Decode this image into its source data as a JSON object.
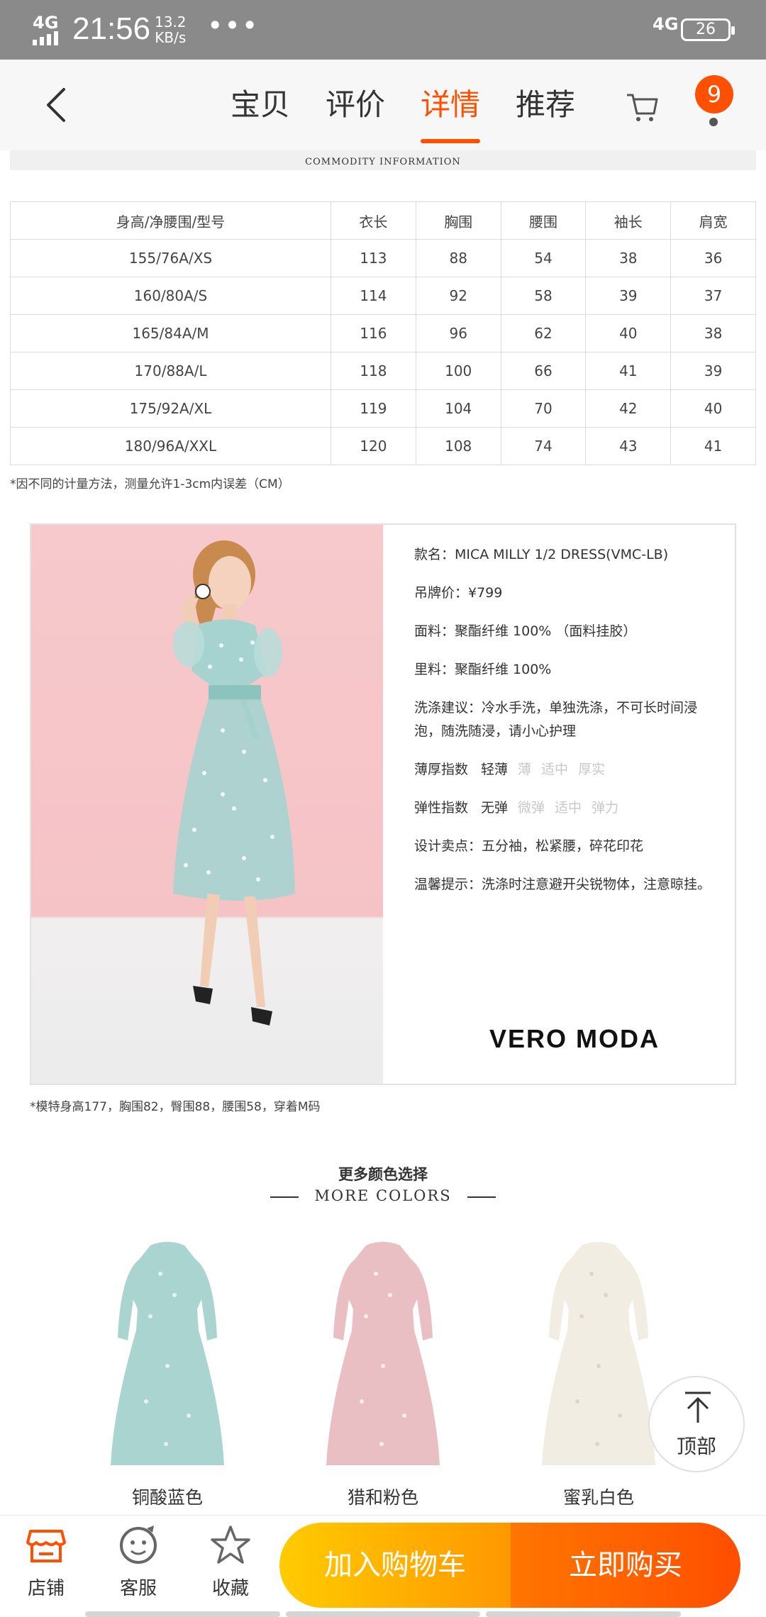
{
  "status_bar": {
    "network_left": "4G",
    "time": "21:56",
    "speed_value": "13.2",
    "speed_unit": "KB/s",
    "more": "•••",
    "network_right": "4G",
    "battery": "26"
  },
  "nav": {
    "tabs": [
      {
        "label": "宝贝",
        "active": false
      },
      {
        "label": "评价",
        "active": false
      },
      {
        "label": "详情",
        "active": true
      },
      {
        "label": "推荐",
        "active": false
      }
    ],
    "cart_badge": "9",
    "accent_color": "#ff5000"
  },
  "commodity_header": "COMMODITY INFORMATION",
  "size_table": {
    "headers": [
      "身高/净腰围/型号",
      "衣长",
      "胸围",
      "腰围",
      "袖长",
      "肩宽"
    ],
    "rows": [
      [
        "155/76A/XS",
        "113",
        "88",
        "54",
        "38",
        "36"
      ],
      [
        "160/80A/S",
        "114",
        "92",
        "58",
        "39",
        "37"
      ],
      [
        "165/84A/M",
        "116",
        "96",
        "62",
        "40",
        "38"
      ],
      [
        "170/88A/L",
        "118",
        "100",
        "66",
        "41",
        "39"
      ],
      [
        "175/92A/XL",
        "119",
        "104",
        "70",
        "42",
        "40"
      ],
      [
        "180/96A/XXL",
        "120",
        "108",
        "74",
        "43",
        "41"
      ]
    ],
    "note": "*因不同的计量方法，测量允许1-3cm内误差（CM）"
  },
  "product_info": {
    "name": "款名：MICA MILLY 1/2 DRESS(VMC-LB)",
    "price": "吊牌价：¥799",
    "fabric": "面料：聚酯纤维 100% （面料挂胶）",
    "lining": "里料：聚酯纤维 100%",
    "washing": "洗涤建议：冷水手洗，单独洗涤，不可长时间浸泡，随洗随浸，请小心护理",
    "thickness_label": "薄厚指数",
    "thickness_selected": "轻薄",
    "thickness_options": [
      "薄",
      "适中",
      "厚实"
    ],
    "elasticity_label": "弹性指数",
    "elasticity_selected": "无弹",
    "elasticity_options": [
      "微弹",
      "适中",
      "弹力"
    ],
    "design": "设计卖点：五分袖，松紧腰，碎花印花",
    "tip": "温馨提示：洗涤时注意避开尖锐物体，注意晾挂。",
    "brand": "VERO MODA"
  },
  "model_note": "*模特身高177，胸围82，臀围88，腰围58，穿着M码",
  "more_colors": {
    "title": "更多颜色选择",
    "subtitle": "MORE COLORS",
    "items": [
      {
        "label": "铜酸蓝色",
        "color": "#a9d4d0"
      },
      {
        "label": "猎和粉色",
        "color": "#e9bfc4"
      },
      {
        "label": "蜜乳白色",
        "color": "#f2ede2"
      }
    ]
  },
  "back_to_top": "顶部",
  "bottom_bar": {
    "shop": "店铺",
    "service": "客服",
    "favorite": "收藏",
    "add_to_cart": "加入购物车",
    "buy_now": "立即购买"
  }
}
